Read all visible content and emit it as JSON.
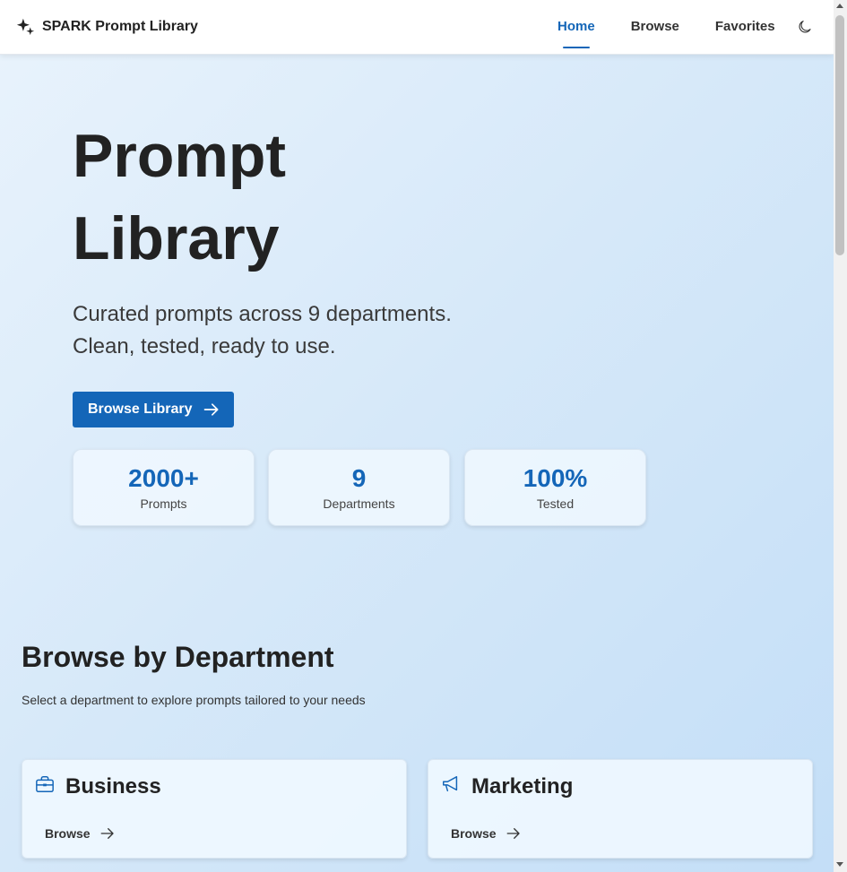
{
  "brand": {
    "name": "SPARK Prompt Library",
    "icon": "sparkles-icon"
  },
  "nav": {
    "links": [
      {
        "label": "Home",
        "active": true
      },
      {
        "label": "Browse",
        "active": false
      },
      {
        "label": "Favorites",
        "active": false
      }
    ],
    "theme_icon": "moon-icon"
  },
  "hero": {
    "title_line1": "Prompt",
    "title_line2": "Library",
    "subtitle_line1": "Curated prompts across 9 departments.",
    "subtitle_line2": "Clean, tested, ready to use.",
    "cta_label": "Browse Library"
  },
  "stats": [
    {
      "value": "2000+",
      "label": "Prompts"
    },
    {
      "value": "9",
      "label": "Departments"
    },
    {
      "value": "100%",
      "label": "Tested"
    }
  ],
  "departments_section": {
    "title": "Browse by Department",
    "subtitle": "Select a department to explore prompts tailored to your needs",
    "cards": [
      {
        "name": "Business",
        "icon": "briefcase-icon",
        "browse_label": "Browse"
      },
      {
        "name": "Marketing",
        "icon": "megaphone-icon",
        "browse_label": "Browse"
      }
    ]
  },
  "colors": {
    "accent": "#1466b8",
    "text": "#222222"
  }
}
